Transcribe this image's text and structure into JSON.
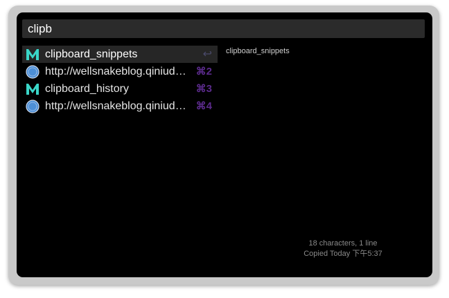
{
  "search": {
    "query": "clipb"
  },
  "results": [
    {
      "icon": "m-logo-icon",
      "title": "clipboard_snippets",
      "shortcut": "↩",
      "selected": true
    },
    {
      "icon": "safari-globe-icon",
      "title": "http://wellsnakeblog.qiniudn.com",
      "shortcut": "⌘2"
    },
    {
      "icon": "m-logo-icon",
      "title": "clipboard_history",
      "shortcut": "⌘3"
    },
    {
      "icon": "safari-globe-icon",
      "title": "http://wellsnakeblog.qiniudn.com",
      "shortcut": "⌘4"
    }
  ],
  "preview": {
    "text": "clipboard_snippets"
  },
  "footer": {
    "line1": "18 characters, 1 line",
    "line2": "Copied Today 下午5:37"
  },
  "colors": {
    "accent_shortcut": "#5a2a8a",
    "m_logo": "#3ad6c8"
  }
}
